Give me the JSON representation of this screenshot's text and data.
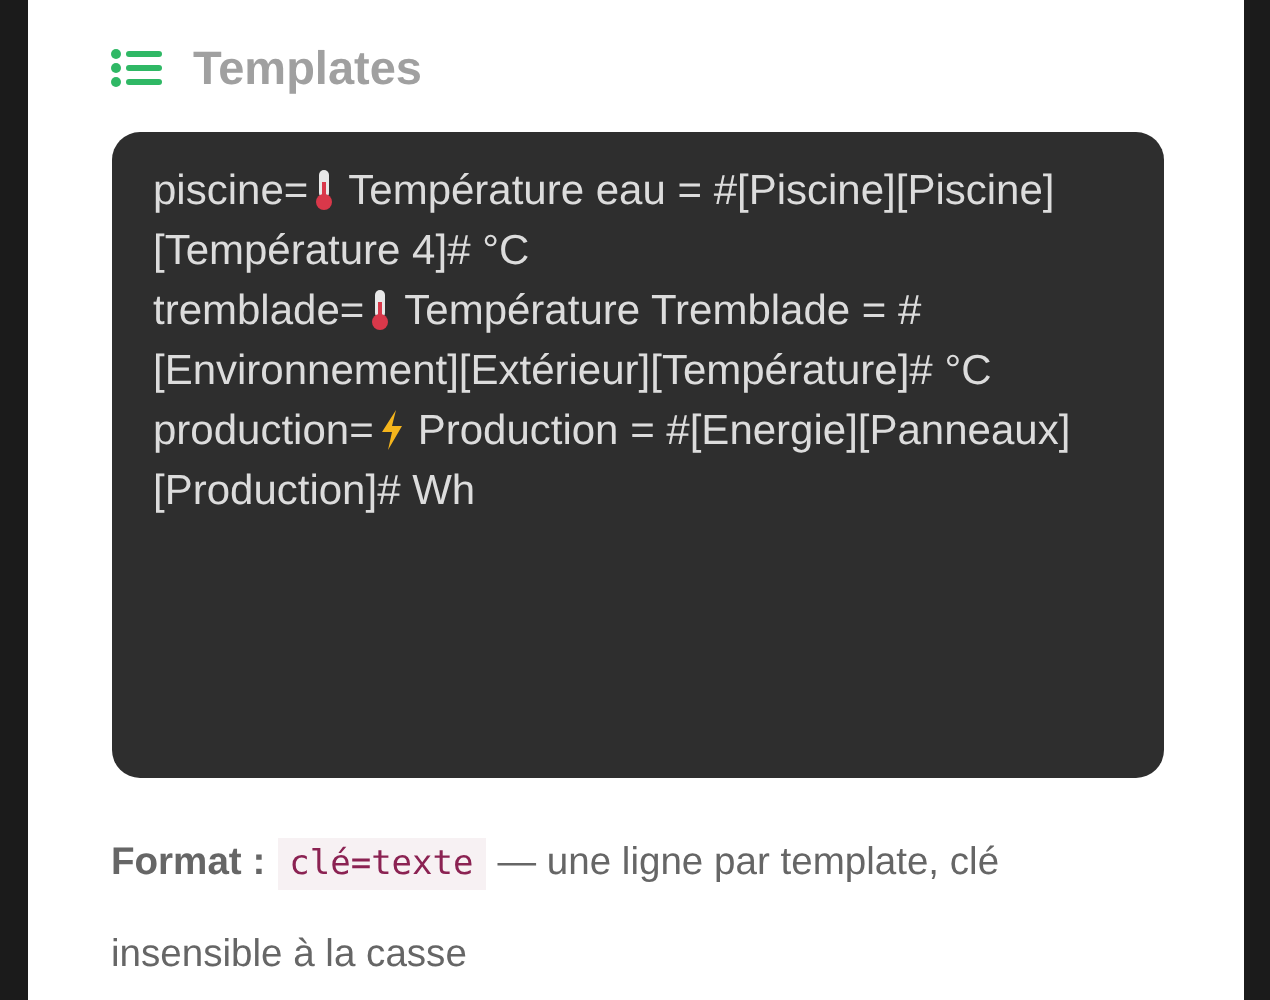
{
  "section": {
    "title": "Templates"
  },
  "templates": [
    {
      "key": "piscine=",
      "kind": "thermometer",
      "text": "Température eau = #[Piscine][Piscine]",
      "continuation": "[Température 4]# °C"
    },
    {
      "key": "tremblade=",
      "kind": "thermometer",
      "text": "Température Tremblade = #",
      "continuation": "[Environnement][Extérieur][Température]# °C"
    },
    {
      "key": "production=",
      "kind": "bolt",
      "text": "Production = #[Energie][Panneaux]",
      "continuation": "[Production]# Wh"
    }
  ],
  "help": {
    "label": "Format :",
    "code": "clé=texte",
    "text": "— une ligne par template, clé",
    "continuation": "insensible à la casse"
  }
}
